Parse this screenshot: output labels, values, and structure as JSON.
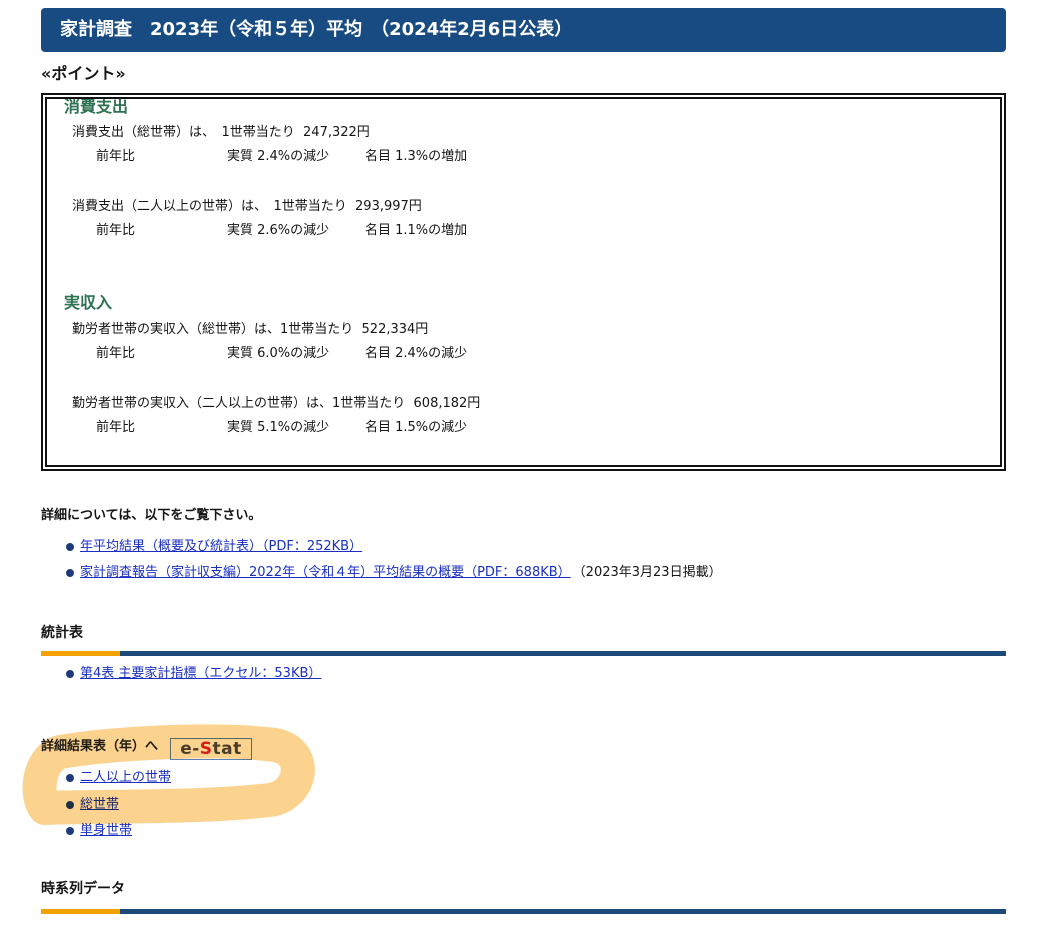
{
  "header": {
    "title": "家計調査　2023年（令和５年）平均　（2024年2月6日公表）"
  },
  "points": {
    "label": "«ポイント»",
    "sections": [
      {
        "heading": "消費支出",
        "items": [
          {
            "summary": "消費支出（総世帯）は、　1世帯当たり  247,322円",
            "yoy_label": "前年比",
            "real": "実質 2.4%の減少",
            "nominal": "名目 1.3%の増加"
          },
          {
            "summary": "消費支出（二人以上の世帯）は、　1世帯当たり  293,997円",
            "yoy_label": "前年比",
            "real": "実質 2.6%の減少",
            "nominal": "名目 1.1%の増加"
          }
        ]
      },
      {
        "heading": "実収入",
        "items": [
          {
            "summary": "勤労者世帯の実収入（総世帯）は、1世帯当たり  522,334円",
            "yoy_label": "前年比",
            "real": "実質 6.0%の減少",
            "nominal": "名目 2.4%の減少"
          },
          {
            "summary": "勤労者世帯の実収入（二人以上の世帯）は、1世帯当たり  608,182円",
            "yoy_label": "前年比",
            "real": "実質 5.1%の減少",
            "nominal": "名目 1.5%の減少"
          }
        ]
      }
    ]
  },
  "details": {
    "intro": "詳細については、以下をご覧下さい。",
    "links": [
      {
        "label": "年平均結果（概要及び統計表）（PDF：252KB）"
      },
      {
        "label": "家計調査報告（家計収支編）2022年（令和４年）平均結果の概要（PDF：688KB）",
        "note": "（2023年3月23日掲載）"
      }
    ]
  },
  "tables": {
    "heading": "統計表",
    "links": [
      {
        "label": "第4表 主要家計指標（エクセル：53KB）"
      }
    ]
  },
  "detail_tables": {
    "heading": "詳細結果表（年）へ",
    "logo": {
      "part1": "e-",
      "part2": "S",
      "part3": "tat"
    },
    "links": [
      {
        "label": "二人以上の世帯"
      },
      {
        "label": "総世帯"
      },
      {
        "label": "単身世帯"
      }
    ]
  },
  "timeseries": {
    "heading": "時系列データ"
  },
  "colors": {
    "header_bg": "#184b82",
    "accent_orange": "#f2a100",
    "rule_blue": "#1c4a7b",
    "heading_green": "#2e7252",
    "link": "#1a2fc2",
    "bullet": "#1e3a7a",
    "annotation": "#fbcf86",
    "estat_red": "#d8232a"
  }
}
